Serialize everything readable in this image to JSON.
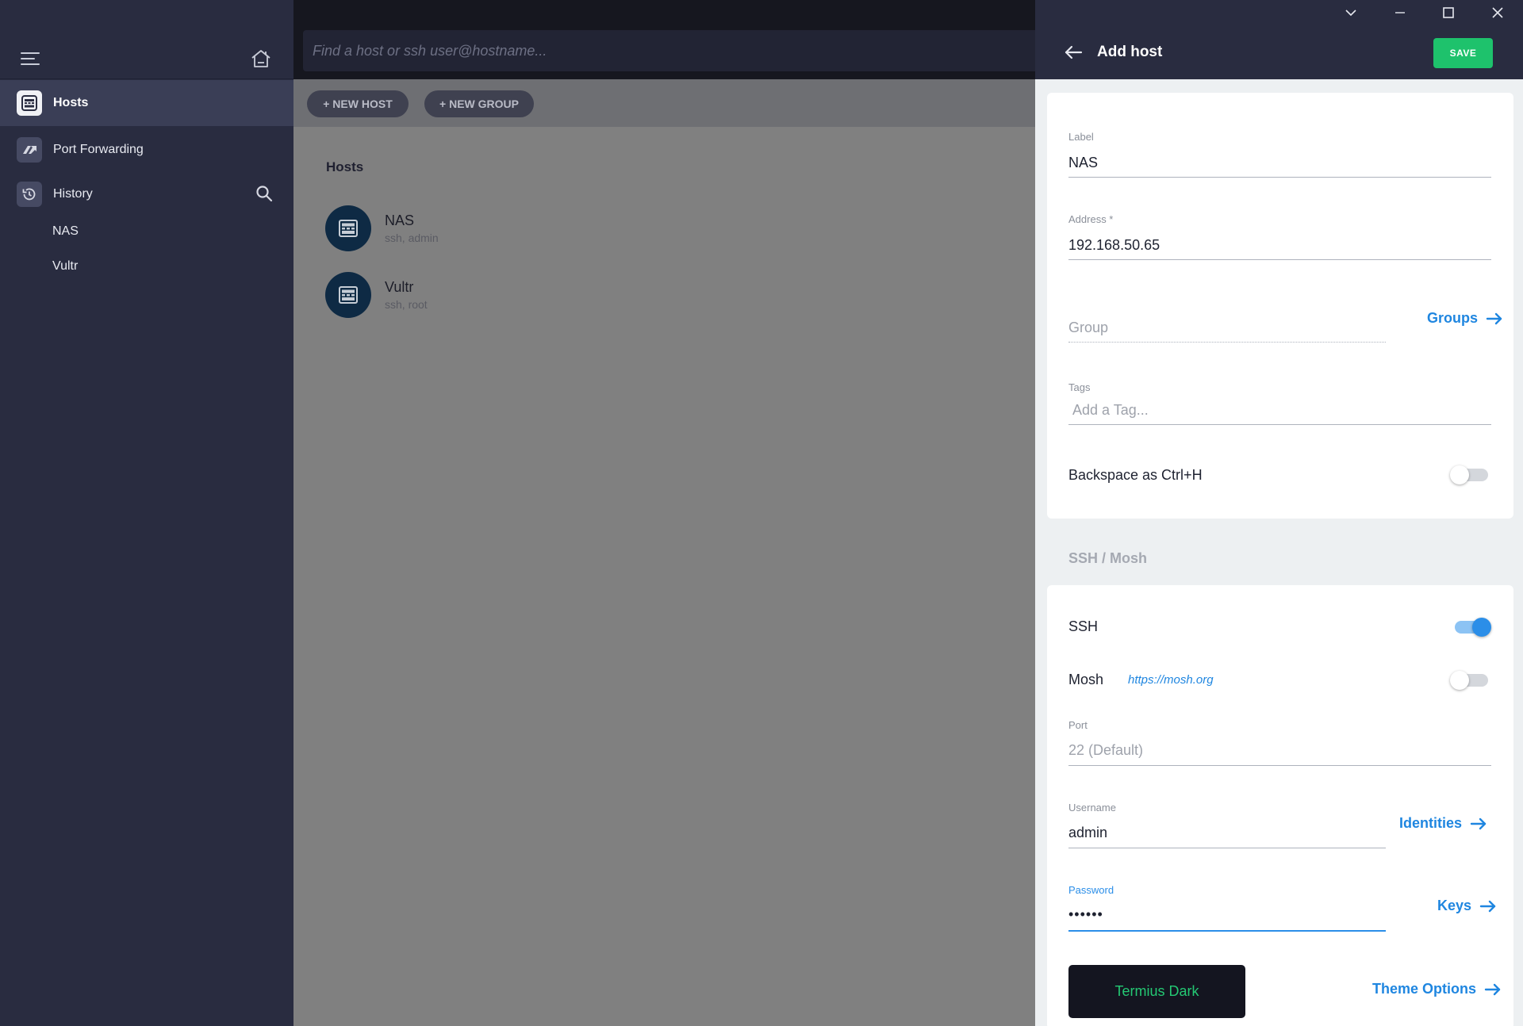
{
  "sidebar": {
    "items": [
      {
        "label": "Hosts",
        "icon": "hosts-icon"
      },
      {
        "label": "Port Forwarding",
        "icon": "port-forwarding-icon"
      },
      {
        "label": "History",
        "icon": "history-icon"
      }
    ],
    "history_entries": [
      "NAS",
      "Vultr"
    ]
  },
  "search": {
    "placeholder": "Find a host or ssh user@hostname..."
  },
  "toolbar": {
    "new_host_label": "+ NEW HOST",
    "new_group_label": "+ NEW GROUP"
  },
  "hosts_list": {
    "title": "Hosts",
    "items": [
      {
        "name": "NAS",
        "sub": "ssh, admin"
      },
      {
        "name": "Vultr",
        "sub": "ssh, root"
      }
    ]
  },
  "panel": {
    "title": "Add host",
    "save_label": "SAVE",
    "label": {
      "label": "Label",
      "value": "NAS"
    },
    "address": {
      "label": "Address *",
      "value": "192.168.50.65"
    },
    "group": {
      "placeholder": "Group",
      "link": "Groups"
    },
    "tags": {
      "label": "Tags",
      "placeholder": "Add a Tag..."
    },
    "backspace": {
      "label": "Backspace as Ctrl+H",
      "on": false
    },
    "ssh_section_title": "SSH / Mosh",
    "ssh": {
      "label": "SSH",
      "on": true
    },
    "mosh": {
      "label": "Mosh",
      "link": "https://mosh.org",
      "on": false
    },
    "port": {
      "label": "Port",
      "placeholder": "22 (Default)"
    },
    "username": {
      "label": "Username",
      "value": "admin",
      "link": "Identities"
    },
    "password": {
      "label": "Password",
      "value": "••••••",
      "link": "Keys"
    },
    "theme": {
      "name": "Termius Dark",
      "link": "Theme Options"
    }
  },
  "colors": {
    "accent": "#2b8ee8",
    "save": "#1ec26c",
    "sidebar_bg": "#292c40",
    "avatar_bg": "#0e2a44"
  }
}
